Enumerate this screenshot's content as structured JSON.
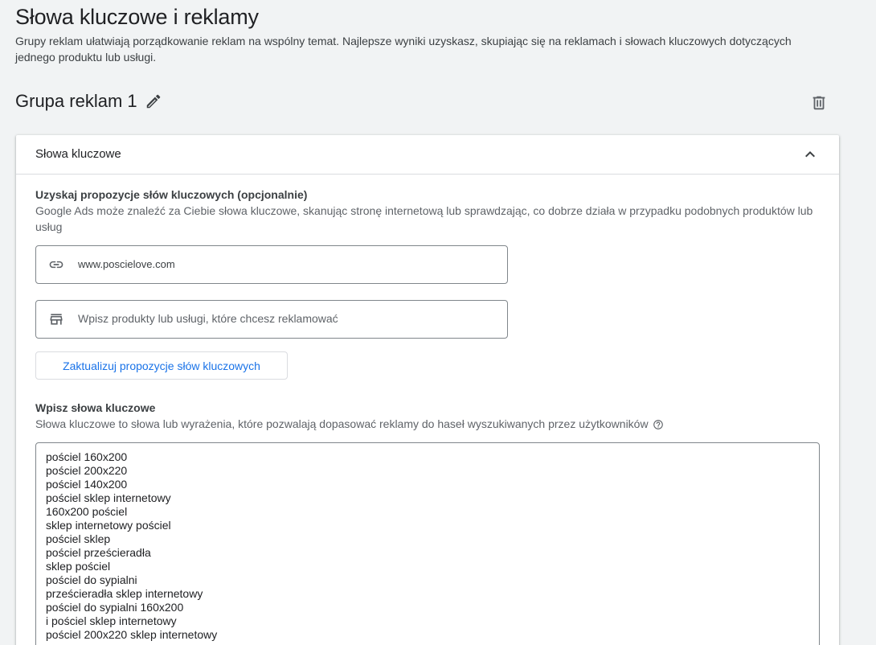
{
  "header": {
    "title": "Słowa kluczowe i reklamy",
    "description": "Grupy reklam ułatwiają porządkowanie reklam na wspólny temat. Najlepsze wyniki uzyskasz, skupiając się na reklamach i słowach kluczowych dotyczących jednego produktu lub usługi."
  },
  "ad_group": {
    "name": "Grupa reklam 1",
    "edit_icon": "pencil-icon",
    "delete_icon": "trash-icon"
  },
  "keywords_card": {
    "title": "Słowa kluczowe",
    "collapse_icon": "chevron-up-icon",
    "suggestions": {
      "title": "Uzyskaj propozycje słów kluczowych (opcjonalnie)",
      "description": "Google Ads może znaleźć za Ciebie słowa kluczowe, skanując stronę internetową lub sprawdzając, co dobrze działa w przypadku podobnych produktów lub usług",
      "url_input": {
        "value": "www.poscielove.com",
        "icon": "link-icon"
      },
      "product_input": {
        "value": "",
        "placeholder": "Wpisz produkty lub usługi, które chcesz reklamować",
        "icon": "store-icon"
      },
      "update_button_label": "Zaktualizuj propozycje słów kluczowych"
    },
    "enter_keywords": {
      "title": "Wpisz słowa kluczowe",
      "description": "Słowa kluczowe to słowa lub wyrażenia, które pozwalają dopasować reklamy do haseł wyszukiwanych przez użytkowników",
      "help_icon": "help-circle-icon",
      "keywords": [
        "pościel 160x200",
        "pościel 200x220",
        "pościel 140x200",
        "pościel sklep internetowy",
        "160x200 pościel",
        "sklep internetowy pościel",
        "pościel sklep",
        "pościel prześcieradła",
        "sklep pościel",
        "pościel do sypialni",
        "prześcieradła sklep internetowy",
        "pościel do sypialni 160x200",
        "i pościel sklep internetowy",
        "pościel 200x220 sklep internetowy"
      ]
    }
  },
  "colors": {
    "background": "#f1f3f4",
    "card": "#ffffff",
    "accent": "#1a73e8",
    "border": "#80868b"
  }
}
